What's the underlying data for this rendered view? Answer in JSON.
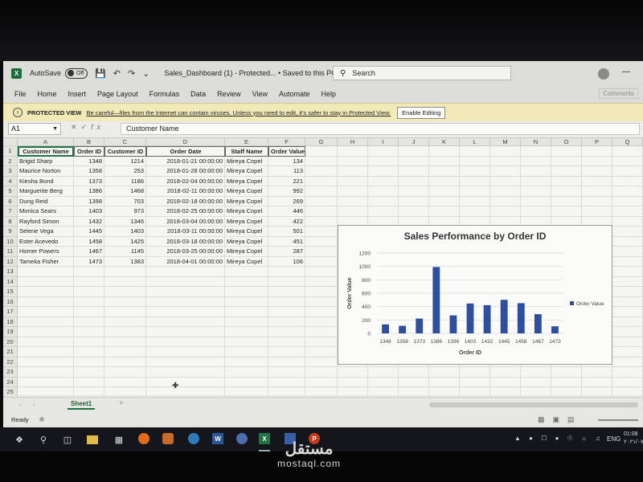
{
  "titlebar": {
    "autosave_label": "AutoSave",
    "autosave_state": "Off",
    "doc_name": "Sales_Dashboard (1)  -  Protected...  •  Saved to this PC ⌄",
    "search_placeholder": "Search"
  },
  "menu": [
    "File",
    "Home",
    "Insert",
    "Page Layout",
    "Formulas",
    "Data",
    "Review",
    "View",
    "Automate",
    "Help"
  ],
  "comments_label": "Comments",
  "protected_view": {
    "title": "PROTECTED VIEW",
    "message": "Be careful—files from the Internet can contain viruses. Unless you need to edit, it's safer to stay in Protected View.",
    "button": "Enable Editing"
  },
  "formula_bar": {
    "name_box": "A1",
    "fx": "fx",
    "content": "Customer Name"
  },
  "columns": [
    "A",
    "B",
    "C",
    "D",
    "E",
    "F",
    "G",
    "H",
    "I",
    "J",
    "K",
    "L",
    "M",
    "N",
    "O",
    "P",
    "Q"
  ],
  "rows": [
    "1",
    "2",
    "3",
    "4",
    "5",
    "6",
    "7",
    "8",
    "9",
    "10",
    "11",
    "12",
    "13",
    "14",
    "15",
    "16",
    "17",
    "18",
    "19",
    "20",
    "21",
    "22",
    "23",
    "24",
    "25"
  ],
  "table": {
    "headers": [
      "Customer Name",
      "Order ID",
      "Customer ID",
      "Order Date",
      "Staff Name",
      "Order Value"
    ],
    "rows": [
      [
        "Brigid Sharp",
        "1348",
        "1214",
        "2018-01-21 00:00:00",
        "Mireya Copel",
        "134"
      ],
      [
        "Maurice Norton",
        "1358",
        "253",
        "2018-01-28 00:00:00",
        "Mireya Copel",
        "113"
      ],
      [
        "Kiesha Bond",
        "1373",
        "1186",
        "2018-02-04 00:00:00",
        "Mireya Copel",
        "221"
      ],
      [
        "Marguerite Berg",
        "1386",
        "1468",
        "2018-02-11 00:00:00",
        "Mireya Copel",
        "992"
      ],
      [
        "Dung Reid",
        "1398",
        "703",
        "2018-02-18 00:00:00",
        "Mireya Copel",
        "269"
      ],
      [
        "Monica Sears",
        "1403",
        "973",
        "2018-02-25 00:00:00",
        "Mireya Copel",
        "446"
      ],
      [
        "Rayford Simon",
        "1432",
        "1346",
        "2018-03-04 00:00:00",
        "Mireya Copel",
        "422"
      ],
      [
        "Selene Vega",
        "1445",
        "1403",
        "2018-03-11 00:00:00",
        "Mireya Copel",
        "501"
      ],
      [
        "Ester Acevedo",
        "1458",
        "1425",
        "2018-03-18 00:00:00",
        "Mireya Copel",
        "451"
      ],
      [
        "Homer Powers",
        "1467",
        "1145",
        "2018-03-25 00:00:00",
        "Mireya Copel",
        "287"
      ],
      [
        "Tameka Fisher",
        "1473",
        "1383",
        "2018-04-01 00:00:00",
        "Mireya Copel",
        "106"
      ]
    ]
  },
  "chart_data": {
    "type": "bar",
    "title": "Sales Performance by Order ID",
    "xlabel": "Order ID",
    "ylabel": "Order Value",
    "categories": [
      "1348",
      "1358",
      "1373",
      "1386",
      "1398",
      "1403",
      "1432",
      "1445",
      "1458",
      "1467",
      "1473"
    ],
    "series": [
      {
        "name": "Order Value",
        "values": [
          134,
          113,
          221,
          992,
          269,
          446,
          422,
          501,
          451,
          287,
          106
        ],
        "color": "#2e4f9e"
      }
    ],
    "ylim": [
      0,
      1200
    ],
    "yticks": [
      "0",
      "200",
      "400",
      "600",
      "800",
      "1000",
      "1200"
    ],
    "grid": true,
    "legend": "right"
  },
  "sheet_tab": "Sheet1",
  "status": "Ready",
  "taskbar": {
    "lang": "ENG",
    "time": "01:08",
    "date": "٢٠٢١/٠٧/٠٨"
  },
  "watermark": {
    "arabic": "مستقل",
    "latin": "mostaql.com"
  }
}
